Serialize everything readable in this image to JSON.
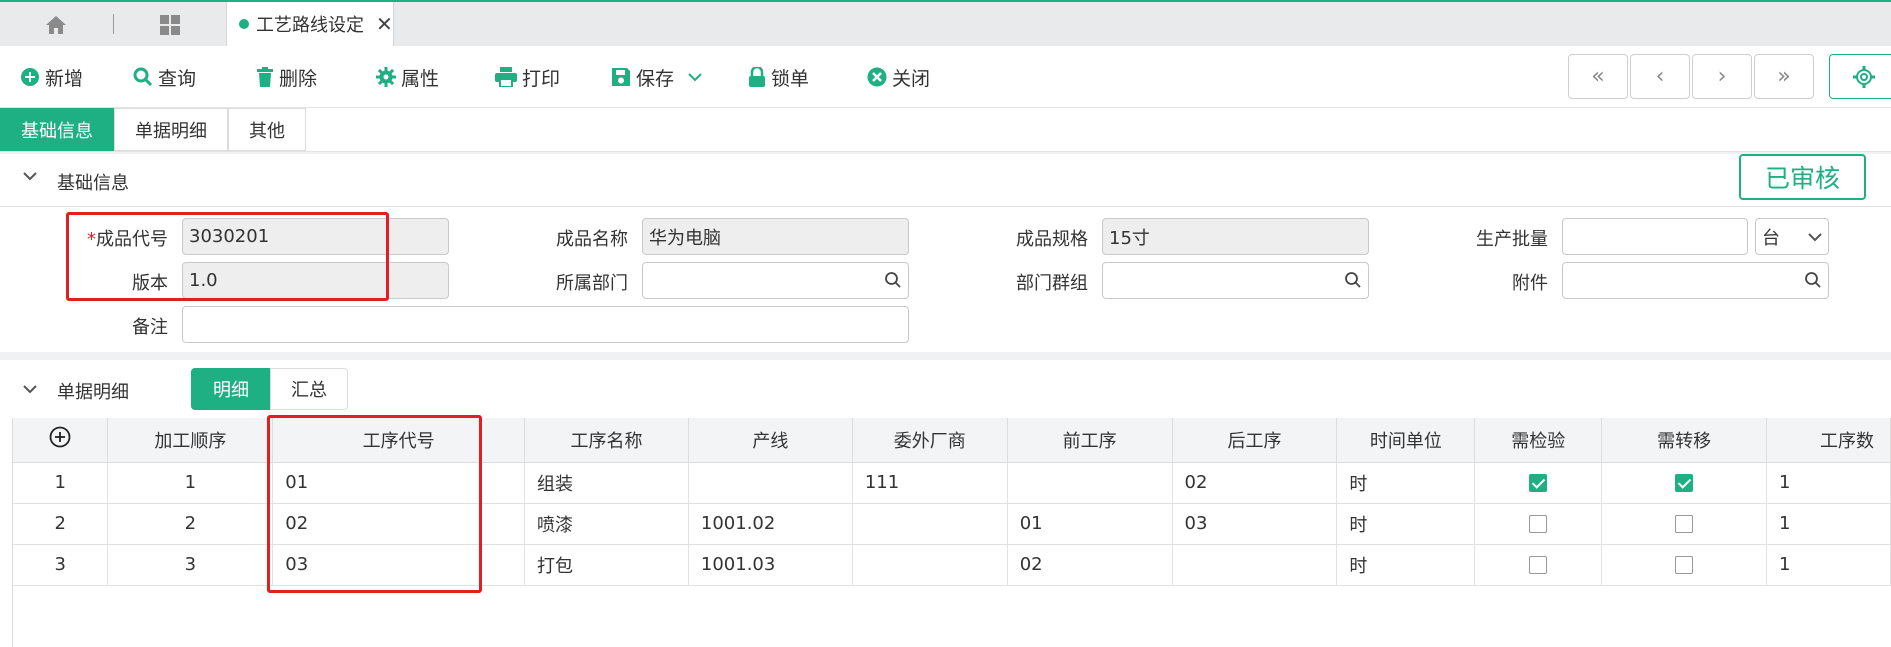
{
  "tab": {
    "title": "工艺路线设定"
  },
  "toolbar": {
    "new": "新增",
    "query": "查询",
    "delete": "删除",
    "props": "属性",
    "print": "打印",
    "save": "保存",
    "lock": "锁单",
    "close": "关闭"
  },
  "nav": {
    "first": "«",
    "prev": "‹",
    "next": "›",
    "last": "»"
  },
  "section_tabs": [
    "基础信息",
    "单据明细",
    "其他"
  ],
  "basic": {
    "title": "基础信息",
    "status": "已审核",
    "fields": {
      "product_code_label": "成品代号",
      "product_code": "3030201",
      "product_name_label": "成品名称",
      "product_name": "华为电脑",
      "product_spec_label": "成品规格",
      "product_spec": "15寸",
      "batch_label": "生产批量",
      "batch": "",
      "unit": "台",
      "version_label": "版本",
      "version": "1.0",
      "dept_label": "所属部门",
      "dept": "",
      "dept_group_label": "部门群组",
      "dept_group": "",
      "attach_label": "附件",
      "attach": "",
      "remark_label": "备注",
      "remark": ""
    }
  },
  "detail": {
    "title": "单据明细",
    "tabs": [
      "明细",
      "汇总"
    ],
    "columns": [
      "加工顺序",
      "工序代号",
      "工序名称",
      "产线",
      "委外厂商",
      "前工序",
      "后工序",
      "时间单位",
      "需检验",
      "需转移",
      "工序数"
    ],
    "rows": [
      {
        "idx": "1",
        "seq": "1",
        "code": "01",
        "name": "组装",
        "line": "",
        "vendor": "111",
        "prev": "",
        "next": "02",
        "unit": "时",
        "inspect": true,
        "transfer": true,
        "count": "1"
      },
      {
        "idx": "2",
        "seq": "2",
        "code": "02",
        "name": "喷漆",
        "line": "1001.02",
        "vendor": "",
        "prev": "01",
        "next": "03",
        "unit": "时",
        "inspect": false,
        "transfer": false,
        "count": "1"
      },
      {
        "idx": "3",
        "seq": "3",
        "code": "03",
        "name": "打包",
        "line": "1001.03",
        "vendor": "",
        "prev": "02",
        "next": "",
        "unit": "时",
        "inspect": false,
        "transfer": false,
        "count": "1"
      }
    ]
  },
  "colors": {
    "accent": "#1eaf83",
    "highlight": "#e02020"
  }
}
